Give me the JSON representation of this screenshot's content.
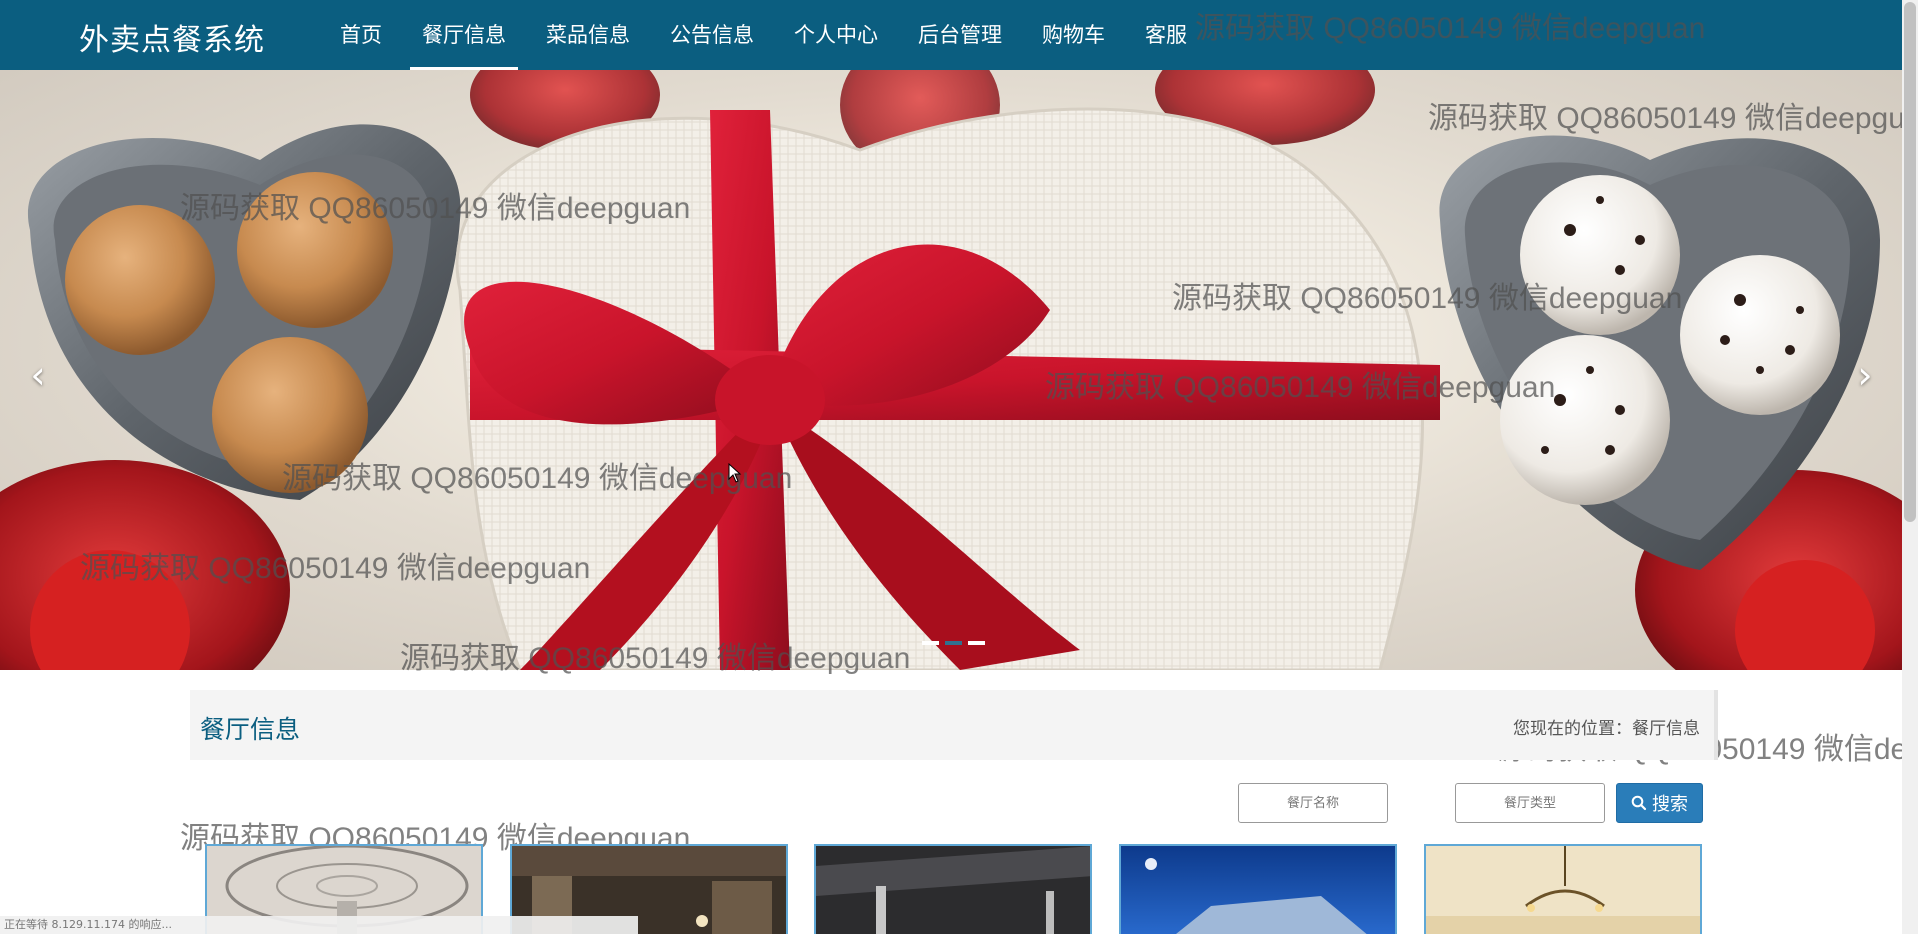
{
  "brand": "外卖点餐系统",
  "nav": {
    "items": [
      {
        "label": "首页"
      },
      {
        "label": "餐厅信息"
      },
      {
        "label": "菜品信息"
      },
      {
        "label": "公告信息"
      },
      {
        "label": "个人中心"
      },
      {
        "label": "后台管理"
      },
      {
        "label": "购物车"
      },
      {
        "label": "客服"
      }
    ],
    "active_index": 1
  },
  "banner": {
    "prev_glyph": "‹",
    "next_glyph": "›",
    "slide_count": 3,
    "active_slide": 1
  },
  "watermark": "源码获取 QQ86050149 微信deepguan",
  "page": {
    "title": "餐厅信息",
    "breadcrumb_label": "您现在的位置：",
    "breadcrumb_current": "餐厅信息"
  },
  "search": {
    "name_placeholder": "餐厅名称",
    "type_placeholder": "餐厅类型",
    "button_label": "搜索"
  },
  "status_bar": "正在等待 8.129.11.174 的响应...",
  "colors": {
    "nav_bg": "#0b5e80",
    "accent": "#2a7db9",
    "card_border": "#5fa8d6"
  }
}
